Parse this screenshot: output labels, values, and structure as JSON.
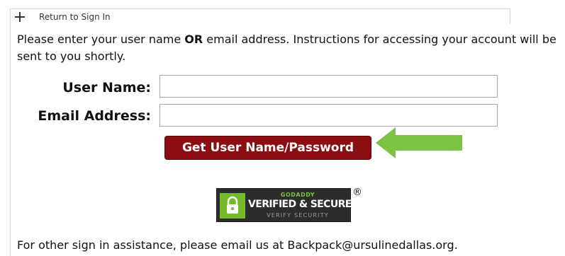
{
  "nav": {
    "return_label": "Return to Sign In"
  },
  "intro": {
    "before": "Please enter your user name ",
    "emphasis": "OR",
    "after": " email address. Instructions for accessing your account will be sent to you shortly."
  },
  "form": {
    "username_label": "User Name:",
    "username_value": "",
    "email_label": "Email Address:",
    "email_value": "",
    "submit_label": "Get User Name/Password"
  },
  "badge": {
    "provider": "GODADDY",
    "title": "VERIFIED & SECURED",
    "subtitle": "VERIFY SECURITY",
    "registered_mark": "®"
  },
  "footer": {
    "text": "For other sign in assistance, please email us at Backpack@ursulinedallas.org."
  },
  "colors": {
    "button_bg": "#8b0d11",
    "arrow": "#7dc242",
    "badge_green": "#76bc2a"
  },
  "icons": {
    "expand": "plus-icon",
    "pointer": "arrow-left-icon",
    "lock": "lock-icon"
  }
}
